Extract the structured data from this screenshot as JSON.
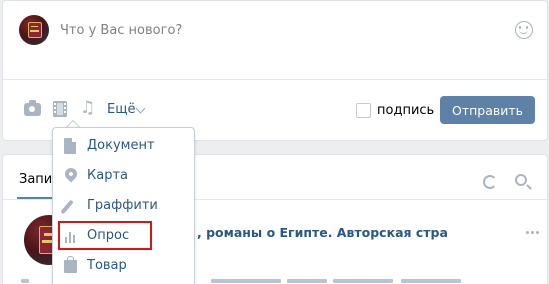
{
  "composer": {
    "placeholder": "Что у Вас нового?",
    "more_label": "Ещё",
    "signature_label": "подпись",
    "send_label": "Отправить",
    "tools": [
      "camera-icon",
      "video-icon",
      "music-icon"
    ]
  },
  "menu": {
    "items": [
      {
        "label": "Документ",
        "icon": "document-icon"
      },
      {
        "label": "Карта",
        "icon": "map-pin-icon"
      },
      {
        "label": "Граффити",
        "icon": "brush-icon"
      },
      {
        "label": "Опрос",
        "icon": "poll-icon",
        "highlighted": true
      },
      {
        "label": "Товар",
        "icon": "bag-icon"
      }
    ]
  },
  "feed": {
    "tab_label": "Запи",
    "post_title": ", романы о Египте. Авторская стра"
  },
  "colors": {
    "accent": "#5181b8",
    "button": "#5e81a8",
    "link": "#2a5885",
    "highlight_border": "#d71616"
  }
}
